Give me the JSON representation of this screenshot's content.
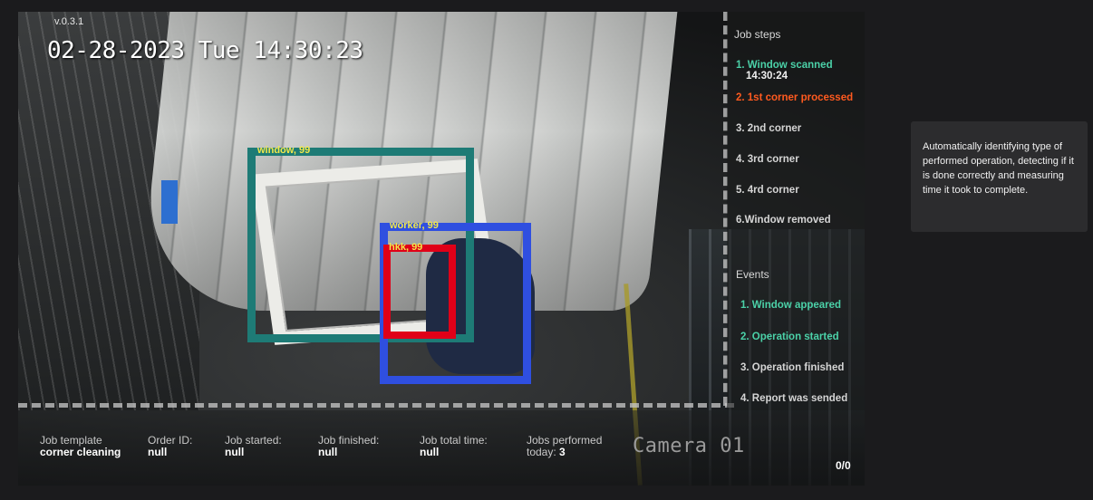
{
  "overlay": {
    "version": "v.0.3.1",
    "timestamp": "02-28-2023 Tue 14:30:23",
    "camera_label": "Camera 01",
    "counter": "0/0"
  },
  "detections": [
    {
      "label": "window, 99",
      "color": "#1e7b76"
    },
    {
      "label": "worker, 99",
      "color": "#2f4fe0"
    },
    {
      "label": "hkk, 99",
      "color": "#e00018"
    }
  ],
  "job_steps": {
    "title": "Job steps",
    "steps": [
      {
        "label": "1. Window scanned",
        "time": "14:30:24",
        "state": "done"
      },
      {
        "label": "2. 1st corner processed",
        "state": "active"
      },
      {
        "label": "3. 2nd corner",
        "state": "pending"
      },
      {
        "label": "4. 3rd corner",
        "state": "pending"
      },
      {
        "label": "5. 4rd corner",
        "state": "pending"
      },
      {
        "label": "6.Window removed",
        "state": "pending"
      }
    ]
  },
  "events": {
    "title": "Events",
    "items": [
      {
        "label": "1. Window appeared",
        "state": "done"
      },
      {
        "label": "2. Operation started",
        "state": "done"
      },
      {
        "label": "3. Operation finished",
        "state": "pending"
      },
      {
        "label": "4. Report was sended",
        "state": "pending"
      }
    ]
  },
  "info_bar": {
    "job_template": {
      "label": "Job template",
      "value": "corner cleaning"
    },
    "order_id": {
      "label": "Order ID:",
      "value": "null"
    },
    "job_started": {
      "label": "Job started:",
      "value": "null"
    },
    "job_finished": {
      "label": "Job finished:",
      "value": "null"
    },
    "job_total_time": {
      "label": "Job total time:",
      "value": "null"
    },
    "jobs_performed": {
      "label": "Jobs performed",
      "label2": "today:",
      "value": "3"
    }
  },
  "tooltip": {
    "text": "Automatically identifying type of performed operation, detecting if it is done correctly and measuring time it took to complete."
  },
  "colors": {
    "done": "#4bd1a8",
    "active": "#ff5a1f",
    "background": "#1b1b1d"
  }
}
